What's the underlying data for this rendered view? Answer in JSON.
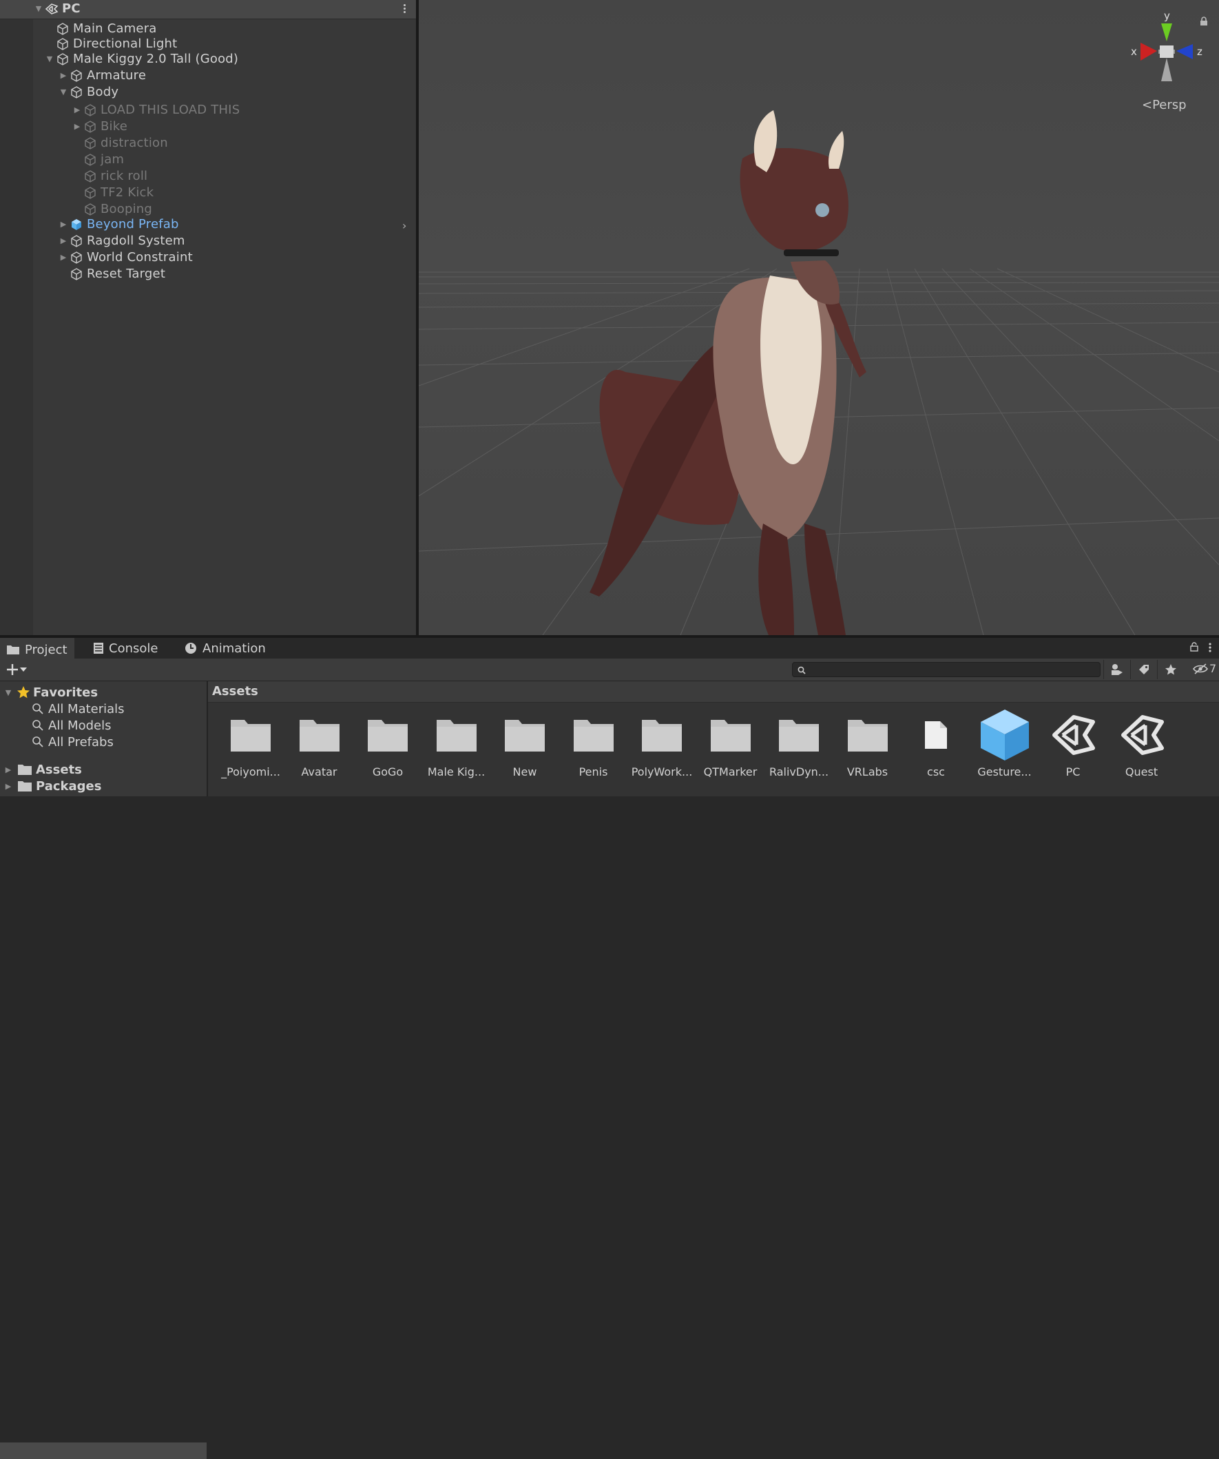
{
  "hierarchy": {
    "scene_name": "PC",
    "items": [
      {
        "label": "Main Camera",
        "state": "normal"
      },
      {
        "label": "Directional Light",
        "state": "normal"
      },
      {
        "label": "Male Kiggy 2.0 Tall (Good)",
        "state": "normal"
      },
      {
        "label": "Armature",
        "state": "normal"
      },
      {
        "label": "Body",
        "state": "normal"
      },
      {
        "label": "LOAD THIS LOAD THIS",
        "state": "inactive"
      },
      {
        "label": "Bike",
        "state": "inactive"
      },
      {
        "label": "distraction",
        "state": "inactive"
      },
      {
        "label": "jam",
        "state": "inactive"
      },
      {
        "label": "rick roll",
        "state": "inactive"
      },
      {
        "label": "TF2 Kick",
        "state": "inactive"
      },
      {
        "label": "Booping",
        "state": "inactive"
      },
      {
        "label": "Beyond Prefab",
        "state": "prefab"
      },
      {
        "label": "Ragdoll System",
        "state": "normal"
      },
      {
        "label": "World Constraint",
        "state": "normal"
      },
      {
        "label": "Reset Target",
        "state": "normal"
      }
    ]
  },
  "scene_view": {
    "projection_label": "Persp",
    "gizmo": {
      "x": "x",
      "y": "y",
      "z": "z"
    },
    "colors": {
      "x_axis": "#cc2222",
      "y_axis": "#6ccc22",
      "z_axis": "#2244cc",
      "background": "#474747"
    }
  },
  "bottom_tabs": [
    {
      "label": "Project",
      "icon": "folder-icon",
      "active": true
    },
    {
      "label": "Console",
      "icon": "console-icon",
      "active": false
    },
    {
      "label": "Animation",
      "icon": "animation-clock-icon",
      "active": false
    }
  ],
  "project": {
    "search": {
      "value": "",
      "placeholder": ""
    },
    "hidden_count": "7",
    "tree": {
      "favorites_label": "Favorites",
      "favorites": [
        "All Materials",
        "All Models",
        "All Prefabs"
      ],
      "roots": [
        "Assets",
        "Packages"
      ]
    },
    "breadcrumb": "Assets",
    "assets": [
      {
        "name": "_Poiyomi...",
        "type": "folder"
      },
      {
        "name": "Avatar",
        "type": "folder"
      },
      {
        "name": "GoGo",
        "type": "folder"
      },
      {
        "name": "Male Kig...",
        "type": "folder"
      },
      {
        "name": "New",
        "type": "folder"
      },
      {
        "name": "Penis",
        "type": "folder"
      },
      {
        "name": "PolyWork...",
        "type": "folder"
      },
      {
        "name": "QTMarker",
        "type": "folder"
      },
      {
        "name": "RalivDyn...",
        "type": "folder"
      },
      {
        "name": "VRLabs",
        "type": "folder"
      },
      {
        "name": "csc",
        "type": "file"
      },
      {
        "name": "Gesture...",
        "type": "prefab"
      },
      {
        "name": "PC",
        "type": "unity-scene"
      },
      {
        "name": "Quest",
        "type": "unity-scene"
      }
    ]
  },
  "colors": {
    "accent_prefab": "#7ab6f5",
    "favorite_star": "#f2c028",
    "panel": "#383838"
  }
}
